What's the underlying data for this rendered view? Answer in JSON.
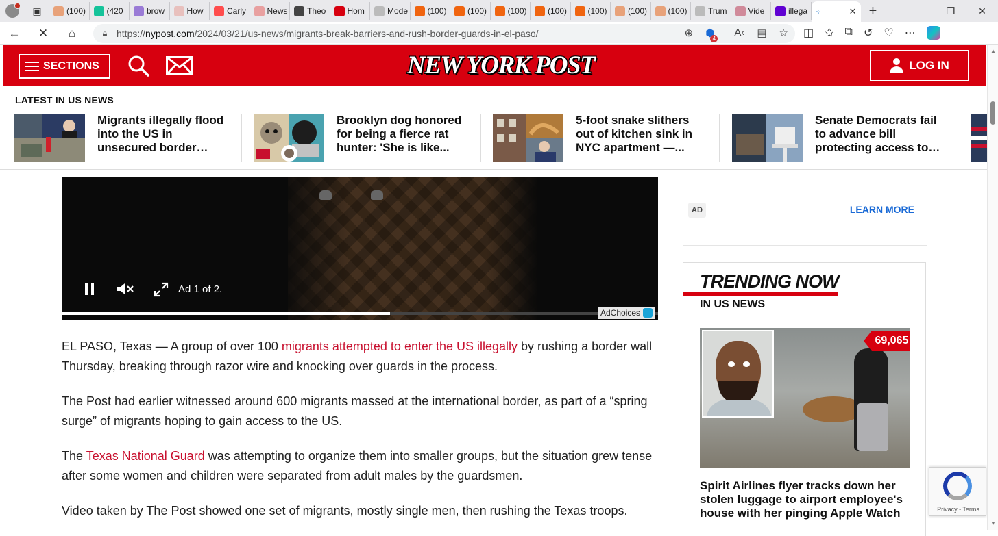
{
  "browser": {
    "tabs": [
      {
        "label": "(100)",
        "icon": "substack-icon",
        "color": "#e8a27a"
      },
      {
        "label": "(420",
        "icon": "grammarly-icon",
        "color": "#15c39a"
      },
      {
        "label": "brow",
        "icon": "yahoo-icon",
        "color": "#9a7bd6"
      },
      {
        "label": "How",
        "icon": "business-insider-icon",
        "color": "#e8c0bd"
      },
      {
        "label": "Carly",
        "icon": "youtube-icon",
        "color": "#ff4d4d"
      },
      {
        "label": "News",
        "icon": "news-icon",
        "color": "#e8a0a0"
      },
      {
        "label": "Theo",
        "icon": "x-icon",
        "color": "#444444"
      },
      {
        "label": "Hom",
        "icon": "home-icon",
        "color": "#d7000f"
      },
      {
        "label": "Mode",
        "icon": "ai-icon",
        "color": "#bbbbbb"
      },
      {
        "label": "(100)",
        "icon": "substack-icon",
        "color": "#f0640f"
      },
      {
        "label": "(100)",
        "icon": "substack-icon",
        "color": "#f0640f"
      },
      {
        "label": "(100)",
        "icon": "substack-icon",
        "color": "#f0640f"
      },
      {
        "label": "(100)",
        "icon": "substack-icon",
        "color": "#f0640f"
      },
      {
        "label": "(100)",
        "icon": "substack-icon",
        "color": "#f0640f"
      },
      {
        "label": "(100)",
        "icon": "substack-icon",
        "color": "#e8a27a"
      },
      {
        "label": "(100)",
        "icon": "substack-icon",
        "color": "#e8a27a"
      },
      {
        "label": "Trum",
        "icon": "page-icon",
        "color": "#bbbbbb"
      },
      {
        "label": "Vide",
        "icon": "star-icon",
        "color": "#d08a9a"
      },
      {
        "label": "illega",
        "icon": "yahoo-icon",
        "color": "#6001d2"
      }
    ],
    "active_tab": {
      "icon": "loading-icon"
    },
    "url_prefix": "https://",
    "url_domain": "nypost.com",
    "url_path": "/2024/03/21/us-news/migrants-break-barriers-and-rush-border-guards-in-el-paso/",
    "extension_badge": "4"
  },
  "header": {
    "sections_label": "SECTIONS",
    "logo_text": "NEW YORK POST",
    "login_label": "LOG IN",
    "brand_color": "#d7000f"
  },
  "latest": {
    "label": "LATEST IN US NEWS",
    "items": [
      {
        "headline": "Migrants illegally flood into the US in unsecured border…"
      },
      {
        "headline": "Brooklyn dog honored for being a fierce rat hunter: 'She is like..."
      },
      {
        "headline": "5-foot snake slithers out of kitchen sink in NYC apartment —..."
      },
      {
        "headline": "Senate Democrats fail to advance bill protecting access to…"
      }
    ]
  },
  "video": {
    "ad_label": "Ad 1 of 2.",
    "adchoices_label": "AdChoices",
    "progress": 0.55
  },
  "article": {
    "p1_before": "EL PASO, Texas — A group of over 100 ",
    "p1_link": "migrants attempted to enter the US illegally",
    "p1_after": " by rushing a border wall Thursday, breaking through razor wire and knocking over guards in the process.",
    "p2": "The Post had earlier witnessed around 600 migrants massed at the international border, as part of a “spring surge” of migrants hoping to gain access to the US.",
    "p3_before": "The ",
    "p3_link": "Texas National Guard",
    "p3_after": " was attempting to organize them into smaller groups, but the situation grew tense after some women and children were separated from adult males by the guardsmen.",
    "p4": "Video taken by The Post showed one set of migrants, mostly single men, then rushing the Texas troops."
  },
  "sidebar": {
    "ad_tag": "AD",
    "learn_more": "LEARN MORE",
    "trending_title": "TRENDING NOW",
    "trending_sub": "IN US NEWS",
    "views": "69,065",
    "trend_headline": "Spirit Airlines flyer tracks down her stolen luggage to airport employee's house with her pinging Apple Watch"
  },
  "recaptcha": {
    "text": "Privacy - Terms"
  }
}
